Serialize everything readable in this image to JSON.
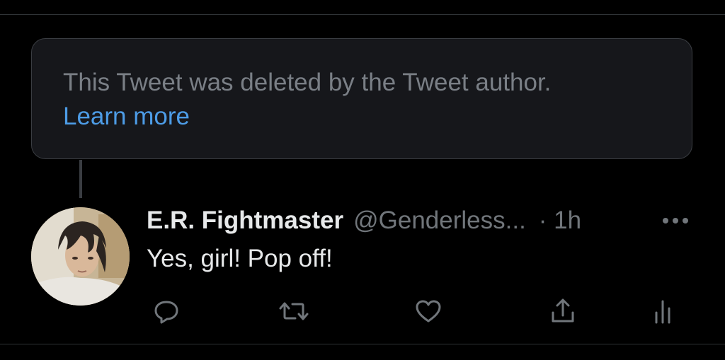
{
  "deleted_notice": {
    "text": "This Tweet was deleted by the Tweet author.",
    "link_label": "Learn more"
  },
  "tweet": {
    "author_name": "E.R. Fightmaster",
    "author_handle": "@Genderless...",
    "timestamp": "· 1h",
    "text": "Yes, girl! Pop off!"
  },
  "actions": [
    {
      "icon": "reply-icon"
    },
    {
      "icon": "retweet-icon"
    },
    {
      "icon": "like-icon"
    },
    {
      "icon": "share-icon"
    },
    {
      "icon": "analytics-icon"
    }
  ],
  "colors": {
    "background": "#000000",
    "card_background": "#16171b",
    "link": "#4d9ce6",
    "secondary_text": "#71767b",
    "primary_text": "#e7e9ea"
  }
}
